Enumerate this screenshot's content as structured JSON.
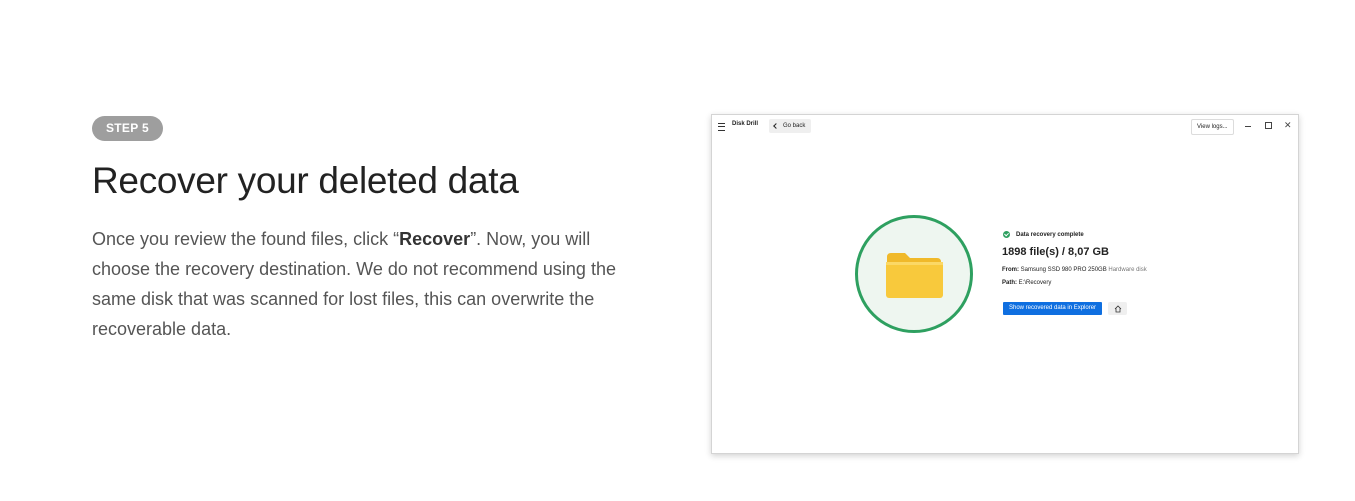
{
  "step": {
    "badge": "STEP 5"
  },
  "headline": "Recover your deleted data",
  "description": {
    "part1": "Once you review the found files, click “",
    "bold": "Recover",
    "part2": "”. Now, you will choose the recovery destination. We do not recommend using the same disk that was scanned for lost files, this can overwrite the recoverable data."
  },
  "app": {
    "title": "Disk Drill",
    "go_back_label": "Go back",
    "view_logs_label": "View logs...",
    "close_glyph": "✕",
    "status": "Data recovery complete",
    "summary": "1898 file(s) / 8,07 GB",
    "from_label": "From:",
    "from_value": "Samsung SSD 980 PRO 250GB",
    "from_tag": "Hardware disk",
    "path_label": "Path:",
    "path_value": "E:\\Recovery",
    "show_button_label": "Show recovered data in Explorer",
    "icons": [
      "menu-icon",
      "chevron-left-icon",
      "minimize-icon",
      "maximize-icon",
      "close-icon",
      "folder-icon",
      "check-circle-icon",
      "home-icon"
    ]
  },
  "colors": {
    "badge_bg": "#9e9e9e",
    "success_green": "#2ea060",
    "primary_blue": "#0f6fe0",
    "folder_yellow": "#f8c93c"
  }
}
